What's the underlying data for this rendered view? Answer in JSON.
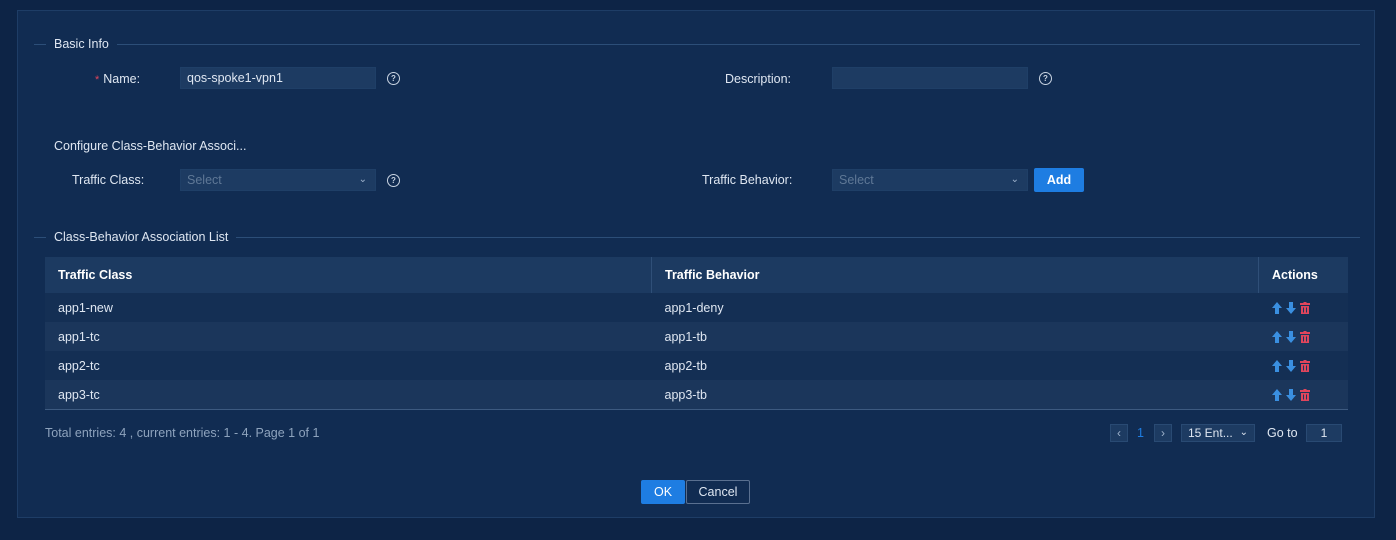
{
  "basic_info": {
    "section_title": "Basic Info",
    "name_required_mark": "*",
    "name_label": "Name:",
    "name_value": "qos-spoke1-vpn1",
    "description_label": "Description:",
    "description_value": ""
  },
  "association": {
    "title": "Configure Class-Behavior Associ...",
    "traffic_class_label": "Traffic Class:",
    "traffic_class_placeholder": "Select",
    "traffic_behavior_label": "Traffic Behavior:",
    "traffic_behavior_placeholder": "Select",
    "add_label": "Add"
  },
  "list": {
    "section_title": "Class-Behavior Association List",
    "columns": [
      "Traffic Class",
      "Traffic Behavior",
      "Actions"
    ],
    "rows": [
      {
        "traffic_class": "app1-new",
        "traffic_behavior": "app1-deny"
      },
      {
        "traffic_class": "app1-tc",
        "traffic_behavior": "app1-tb"
      },
      {
        "traffic_class": "app2-tc",
        "traffic_behavior": "app2-tb"
      },
      {
        "traffic_class": "app3-tc",
        "traffic_behavior": "app3-tb"
      }
    ],
    "action_icons": [
      "arrow-up-icon",
      "arrow-down-icon",
      "trash-icon"
    ]
  },
  "pagination": {
    "summary": "Total entries: 4 , current entries: 1 - 4. Page 1 of 1",
    "current_page": "1",
    "page_size": "15 Ent...",
    "goto_label": "Go to",
    "goto_value": "1"
  },
  "footer": {
    "ok_label": "OK",
    "cancel_label": "Cancel"
  },
  "colors": {
    "accent": "#1e7de2",
    "danger": "#e0455c",
    "background": "#112c52"
  }
}
